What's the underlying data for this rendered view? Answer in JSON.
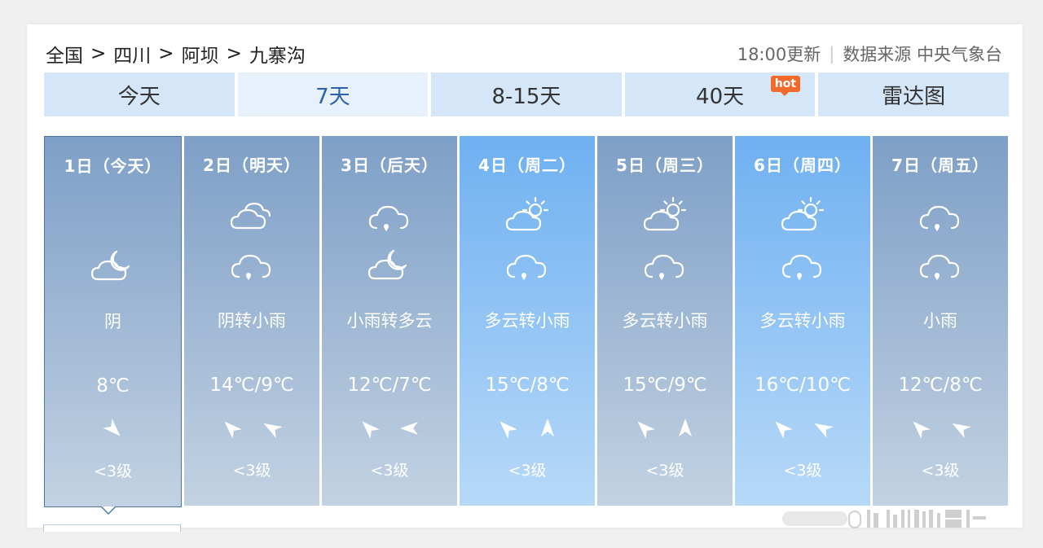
{
  "breadcrumb": [
    "全国",
    "四川",
    "阿坝",
    "九寨沟"
  ],
  "breadcrumb_sep": ">",
  "meta": {
    "update_time": "18:00更新",
    "source": "数据来源 中央气象台"
  },
  "tabs": [
    {
      "label": "今天",
      "active": false
    },
    {
      "label": "7天",
      "active": true
    },
    {
      "label": "8-15天",
      "active": false
    },
    {
      "label": "40天",
      "active": false,
      "badge": "hot"
    },
    {
      "label": "雷达图",
      "active": false
    }
  ],
  "days": [
    {
      "date": "1日（今天）",
      "desc": "阴",
      "temp": "8℃",
      "level": "<3级",
      "icons": [
        "cloud-moon-icon"
      ],
      "winds": [
        135
      ],
      "style": "selected"
    },
    {
      "date": "2日（明天）",
      "desc": "阴转小雨",
      "temp": "14℃/9℃",
      "level": "<3级",
      "icons": [
        "overcast-icon",
        "rain-icon"
      ],
      "winds": [
        315,
        300
      ],
      "style": "cloudy"
    },
    {
      "date": "3日（后天）",
      "desc": "小雨转多云",
      "temp": "12℃/7℃",
      "level": "<3级",
      "icons": [
        "rain-icon",
        "cloud-moon-icon"
      ],
      "winds": [
        315,
        270
      ],
      "style": "cloudy"
    },
    {
      "date": "4日（周二）",
      "desc": "多云转小雨",
      "temp": "15℃/8℃",
      "level": "<3级",
      "icons": [
        "partly-sunny-icon",
        "rain-icon"
      ],
      "winds": [
        315,
        0
      ],
      "style": "sunny"
    },
    {
      "date": "5日（周三）",
      "desc": "多云转小雨",
      "temp": "15℃/9℃",
      "level": "<3级",
      "icons": [
        "partly-sunny-icon",
        "rain-icon"
      ],
      "winds": [
        315,
        0
      ],
      "style": "cloudy"
    },
    {
      "date": "6日（周四）",
      "desc": "多云转小雨",
      "temp": "16℃/10℃",
      "level": "<3级",
      "icons": [
        "partly-sunny-icon",
        "rain-icon"
      ],
      "winds": [
        315,
        300
      ],
      "style": "sunny"
    },
    {
      "date": "7日（周五）",
      "desc": "小雨",
      "temp": "12℃/8℃",
      "level": "<3级",
      "icons": [
        "rain-icon",
        "rain-icon"
      ],
      "winds": [
        315,
        300
      ],
      "style": "cloudy"
    }
  ],
  "colors": {
    "card_cloudy_top": "#7e9fc7",
    "card_sunny_top": "#6fb0f1",
    "tab_bg": "#d4e6f7",
    "tab_active_text": "#2b61a9",
    "hot_badge": "#f26a2a"
  }
}
